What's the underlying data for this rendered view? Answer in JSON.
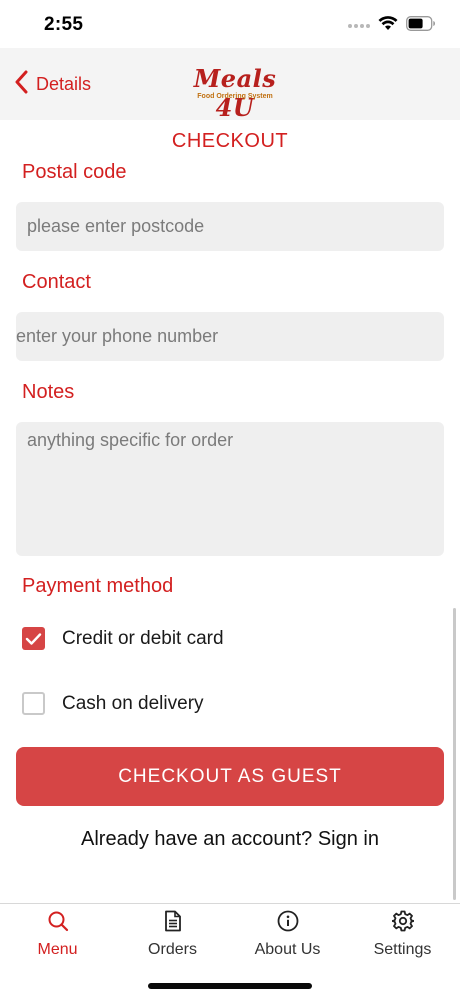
{
  "status": {
    "time": "2:55"
  },
  "nav": {
    "back_label": "Details",
    "logo_title": "Meals 4U",
    "logo_subtitle": "Food Ordering System"
  },
  "page": {
    "title": "CHECKOUT"
  },
  "form": {
    "postal": {
      "label": "Postal code",
      "placeholder": "please enter postcode"
    },
    "contact": {
      "label": "Contact",
      "placeholder": "enter your phone number"
    },
    "notes": {
      "label": "Notes",
      "placeholder": "anything specific for order"
    },
    "payment": {
      "label": "Payment method",
      "options": [
        {
          "label": "Credit or debit card",
          "checked": true
        },
        {
          "label": "Cash on delivery",
          "checked": false
        }
      ]
    }
  },
  "actions": {
    "checkout_label": "CHECKOUT AS GUEST",
    "signin_text": "Already have an account? Sign in"
  },
  "tabs": [
    {
      "label": "Menu",
      "icon": "search-icon",
      "active": true
    },
    {
      "label": "Orders",
      "icon": "document-icon",
      "active": false
    },
    {
      "label": "About Us",
      "icon": "info-icon",
      "active": false
    },
    {
      "label": "Settings",
      "icon": "gear-icon",
      "active": false
    }
  ],
  "colors": {
    "accent": "#d32020",
    "button": "#d64545",
    "field_bg": "#efefef",
    "nav_bg": "#f4f4f4"
  }
}
